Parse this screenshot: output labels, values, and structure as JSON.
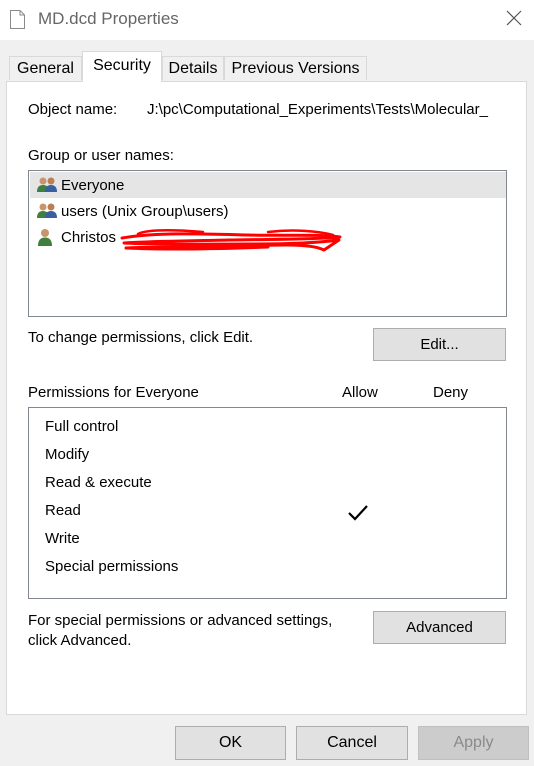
{
  "window": {
    "title": "MD.dcd Properties",
    "icons": {
      "document": "document-icon",
      "close": "close-icon"
    }
  },
  "tabs": [
    {
      "label": "General",
      "active": false
    },
    {
      "label": "Security",
      "active": true
    },
    {
      "label": "Details",
      "active": false
    },
    {
      "label": "Previous Versions",
      "active": false
    }
  ],
  "security": {
    "object_name_label": "Object name:",
    "object_name_value": "J:\\pc\\Computational_Experiments\\Tests\\Molecular_",
    "group_label": "Group or user names:",
    "users": [
      {
        "label": "Everyone",
        "icon": "group-icon",
        "selected": true
      },
      {
        "label": "users (Unix Group\\users)",
        "icon": "group-icon",
        "selected": false
      },
      {
        "label": "Christos",
        "icon": "user-icon",
        "selected": false,
        "redacted": true
      }
    ],
    "change_hint": "To change permissions, click Edit.",
    "edit_button": "Edit...",
    "permissions_label": "Permissions for Everyone",
    "allow_header": "Allow",
    "deny_header": "Deny",
    "permissions": [
      {
        "name": "Full control",
        "allow": false,
        "deny": false
      },
      {
        "name": "Modify",
        "allow": false,
        "deny": false
      },
      {
        "name": "Read & execute",
        "allow": false,
        "deny": false
      },
      {
        "name": "Read",
        "allow": true,
        "deny": false
      },
      {
        "name": "Write",
        "allow": false,
        "deny": false
      },
      {
        "name": "Special permissions",
        "allow": false,
        "deny": false
      }
    ],
    "advanced_hint_line1": "For special permissions or advanced settings,",
    "advanced_hint_line2": "click Advanced.",
    "advanced_button": "Advanced"
  },
  "footer": {
    "ok": "OK",
    "cancel": "Cancel",
    "apply": "Apply",
    "apply_enabled": false
  },
  "colors": {
    "selection": "#e5e5e5",
    "redaction": "#ff0000",
    "window_bg": "#f0f0f0"
  }
}
